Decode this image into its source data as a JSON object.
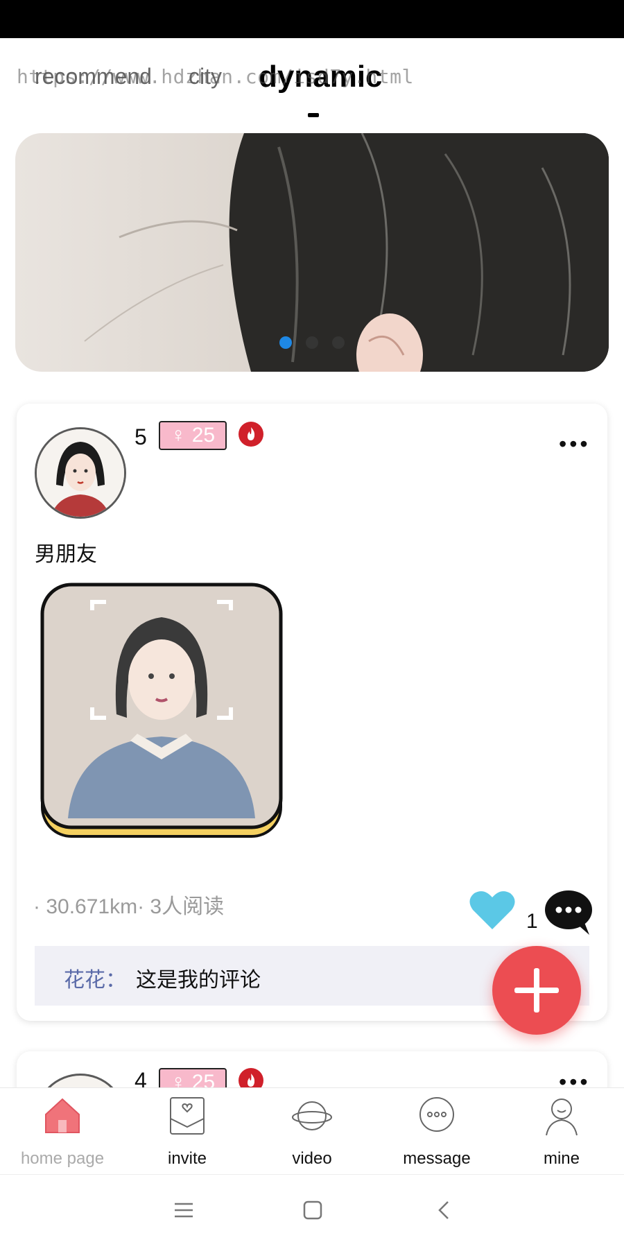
{
  "header": {
    "tabs": [
      {
        "label": "recommend",
        "active": false
      },
      {
        "label": "city",
        "active": false
      },
      {
        "label": "dynamic",
        "active": true
      }
    ],
    "watermark": "https://www.hdzhan.com/isd7y.html"
  },
  "banner": {
    "slide_count": 3,
    "active_slide": 1
  },
  "posts": [
    {
      "level": "5",
      "gender_badge": "♀ 25",
      "text": "男朋友",
      "meta": "· 30.671km· 3人阅读",
      "like_count": "1",
      "comment": {
        "user": "花花：",
        "text": "这是我的评论"
      }
    },
    {
      "level": "4",
      "gender_badge": "♀ 25"
    }
  ],
  "bottom_nav": {
    "items": [
      {
        "label": "home page",
        "icon": "home-icon",
        "active": true
      },
      {
        "label": "invite",
        "icon": "invite-icon",
        "active": false
      },
      {
        "label": "video",
        "icon": "planet-icon",
        "active": false
      },
      {
        "label": "message",
        "icon": "message-icon",
        "active": false
      },
      {
        "label": "mine",
        "icon": "user-icon",
        "active": false
      }
    ]
  },
  "colors": {
    "accent": "#ec4d52",
    "badge_pink": "#f8b9cb",
    "like_blue": "#5bc8e6",
    "dot_active": "#1e88e5"
  }
}
